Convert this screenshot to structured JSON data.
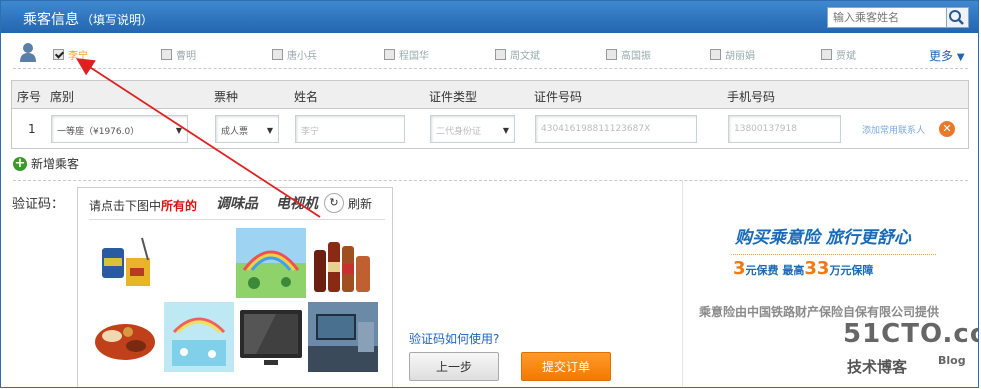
{
  "header": {
    "title": "乘客信息",
    "subtitle": "（填写说明）",
    "search_placeholder": "输入乘客姓名"
  },
  "passengers": [
    {
      "label": "李宁",
      "checked": true
    },
    {
      "label": "曹明",
      "checked": false
    },
    {
      "label": "唐小兵",
      "checked": false
    },
    {
      "label": "程国华",
      "checked": false
    },
    {
      "label": "周文斌",
      "checked": false
    },
    {
      "label": "高国振",
      "checked": false
    },
    {
      "label": "胡丽娟",
      "checked": false
    },
    {
      "label": "贾斌",
      "checked": false
    }
  ],
  "more_label": "更多",
  "table": {
    "headers": [
      "序号",
      "席别",
      "票种",
      "姓名",
      "证件类型",
      "证件号码",
      "手机号码"
    ],
    "row": {
      "index": "1",
      "seat": "一等座（¥1976.0）",
      "ticket": "成人票",
      "name": "李宁",
      "id_type": "二代身份证",
      "id_number": "430416198811123687X",
      "phone": "13800137918",
      "save_link": "添加常用联系人"
    }
  },
  "add_passenger_label": "新增乘客",
  "captcha": {
    "label": "验证码：",
    "prompt_pre": "请点击下图中",
    "prompt_bold": "所有的",
    "word1": "调味品",
    "word2": "电视机",
    "refresh_label": "刷新"
  },
  "howto_link": "验证码如何使用?",
  "buttons": {
    "prev": "上一步",
    "submit": "提交订单"
  },
  "ad": {
    "line1": "购买乘意险  旅行更舒心",
    "line2_num1": "3",
    "line2_text1": "元保费  最高",
    "line2_num2": "33",
    "line2_text2": "万元保障",
    "line3": "乘意险由中国铁路财产保险自保有限公司提供"
  },
  "watermark": {
    "site": "51CTO.com",
    "tagline": "技术博客",
    "blog": "Blog"
  },
  "colors": {
    "header_blue": "#2266b0",
    "link_blue": "#2165b8",
    "submit_orange": "#f27a00",
    "annotation_red": "#e02020"
  }
}
